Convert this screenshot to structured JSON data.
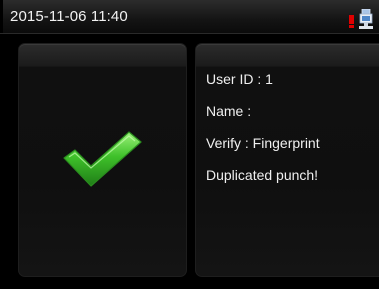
{
  "status_bar": {
    "datetime": "2015-11-06 11:40",
    "icons": [
      "alarm-indicator-icon",
      "network-icon"
    ]
  },
  "result_panel": {
    "icon": "checkmark-icon",
    "icon_color": "#3fc12a"
  },
  "info_panel": {
    "user_id": "User ID : 1",
    "name": "Name :",
    "verify": "Verify : Fingerprint",
    "message": "Duplicated punch!"
  },
  "colors": {
    "background": "#000000",
    "text": "#f0f0f0",
    "alarm": "#e00000",
    "check": "#3fc12a"
  }
}
